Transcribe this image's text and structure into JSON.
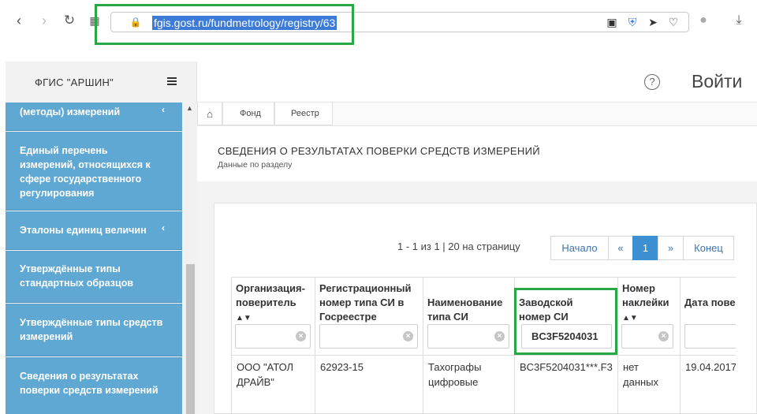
{
  "browser": {
    "url": "fgis.gost.ru/fundmetrology/registry/63",
    "back_icon": "chevron-left-icon",
    "forward_icon": "chevron-right-icon",
    "reload_icon": "reload-icon"
  },
  "app": {
    "title": "ФГИС \"АРШИН\"",
    "login_label": "Войти",
    "help_label": "?"
  },
  "sidebar": {
    "items": [
      {
        "label": "(методы) измерений"
      },
      {
        "label": "Единый перечень измерений, относящихся к сфере государственного регулирования"
      },
      {
        "label": "Эталоны единиц величин"
      },
      {
        "label": "Утверждённые типы стандартных образцов"
      },
      {
        "label": "Утверждённые типы средств измерений"
      },
      {
        "label": "Сведения о результатах поверки средств измерений"
      }
    ]
  },
  "breadcrumb": {
    "home_icon": "home-icon",
    "items": [
      "Фонд",
      "Реестр"
    ]
  },
  "section": {
    "title": "СВЕДЕНИЯ О РЕЗУЛЬТАТАХ ПОВЕРКИ СРЕДСТВ ИЗМЕРЕНИЙ",
    "subtitle": "Данные по разделу"
  },
  "pager": {
    "info": "1 - 1 из 1 | 20 на страницу",
    "first": "Начало",
    "prev": "«",
    "current": "1",
    "next": "»",
    "last": "Конец"
  },
  "table": {
    "columns": [
      {
        "label": "Организация-поверитель",
        "filter": ""
      },
      {
        "label": "Регистрационный номер типа СИ в Госреестре",
        "filter": ""
      },
      {
        "label": "Наименование типа СИ",
        "filter": ""
      },
      {
        "label": "Заводской номер СИ",
        "filter": "BC3F5204031"
      },
      {
        "label": "Номер наклейки",
        "filter": ""
      },
      {
        "label": "Дата пове От",
        "filter": ""
      }
    ],
    "rows": [
      [
        "ООО \"АТОЛ ДРАЙВ\"",
        "62923-15",
        "Тахографы цифровые",
        "BC3F5204031***.F3",
        "нет данных",
        "19.04.2017"
      ]
    ]
  },
  "colors": {
    "sidebar": "#5fa8d3",
    "accent": "#3c8fd1",
    "highlight": "#27a745"
  }
}
